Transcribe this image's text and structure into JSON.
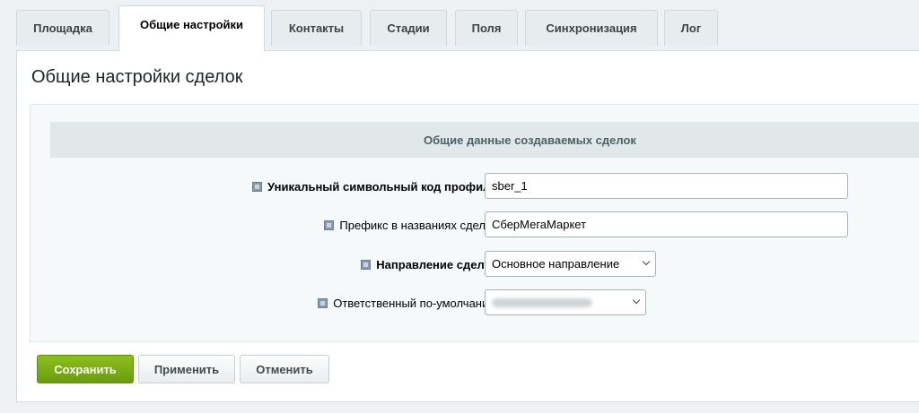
{
  "tabs": [
    {
      "label": "Площадка",
      "active": false
    },
    {
      "label": "Общие настройки",
      "active": true
    },
    {
      "label": "Контакты",
      "active": false
    },
    {
      "label": "Стадии",
      "active": false
    },
    {
      "label": "Поля",
      "active": false
    },
    {
      "label": "Синхронизация",
      "active": false
    },
    {
      "label": "Лог",
      "active": false
    }
  ],
  "page_title": "Общие настройки сделок",
  "section": {
    "title": "Общие данные создаваемых сделок"
  },
  "fields": {
    "profile_code": {
      "label": "Уникальный символьный код профиля",
      "value": "sber_1"
    },
    "deal_prefix": {
      "label": "Префикс в названиях сделок",
      "value": "СберМегаМаркет"
    },
    "deal_direction": {
      "label": "Направление сделок",
      "selected": "Основное направление"
    },
    "responsible": {
      "label": "Ответственный по-умолчанию"
    }
  },
  "buttons": {
    "save": "Сохранить",
    "apply": "Применить",
    "cancel": "Отменить"
  },
  "icons": {
    "help": "help-icon",
    "dropdown": "chevron-down-icon"
  },
  "colors": {
    "primary_button": "#7aae14",
    "background": "#edf1f3",
    "section_header": "#e0e8ea"
  }
}
